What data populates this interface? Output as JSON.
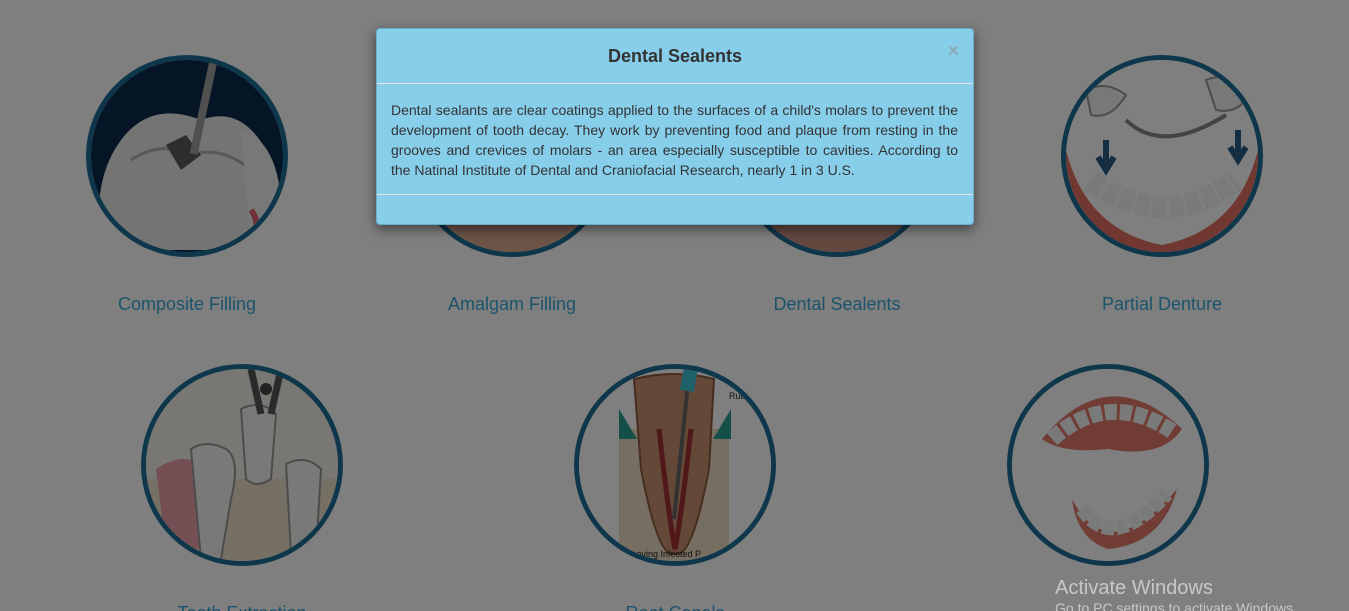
{
  "services": [
    {
      "label": "Composite Filling",
      "icon": "composite-filling-image"
    },
    {
      "label": "Amalgam Filling",
      "icon": "amalgam-filling-image"
    },
    {
      "label": "Dental Sealents",
      "icon": "dental-sealents-image"
    },
    {
      "label": "Partial Denture",
      "icon": "partial-denture-image"
    },
    {
      "label": "Tooth Extraction",
      "icon": "tooth-extraction-image"
    },
    {
      "label": "Root Canals",
      "icon": "root-canals-image",
      "image_text": "moving Infected P",
      "image_text_2": "Rub"
    },
    {
      "label": "",
      "icon": "full-denture-image"
    }
  ],
  "modal": {
    "title": "Dental Sealents",
    "close_symbol": "×",
    "body": "Dental sealants are clear coatings applied to the surfaces of a child's molars to prevent the development of tooth decay. They work by preventing food and plaque from resting in the grooves and crevices of molars - an area especially susceptible to cavities. According to the Natinal Institute of Dental and Craniofacial Research, nearly 1 in 3 U.S."
  },
  "watermark": {
    "title": "Activate Windows",
    "subtitle": "Go to PC settings to activate Windows."
  },
  "colors": {
    "circle_border": "#1f6e97",
    "label": "#3aa8d8",
    "modal_bg": "#87ceeb",
    "overlay": "rgba(0,0,0,0.5)"
  }
}
